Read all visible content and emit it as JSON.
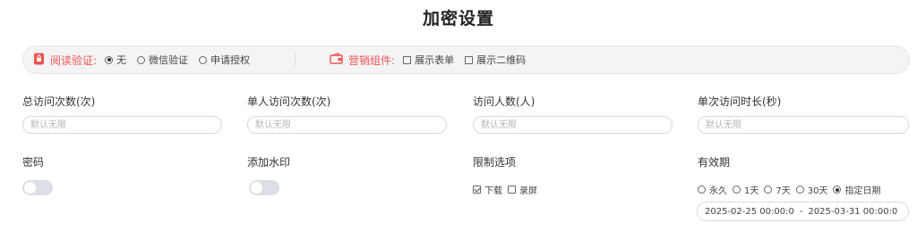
{
  "title": "加密设置",
  "read_verify": {
    "label": "阅读验证:",
    "options": [
      "无",
      "微信验证",
      "申请授权"
    ],
    "selected": 0
  },
  "marketing": {
    "label": "营销组件:",
    "options": [
      "展示表单",
      "展示二维码"
    ]
  },
  "fields": {
    "total_visits": {
      "label": "总访问次数(次)",
      "placeholder": "默认无限"
    },
    "single_visits": {
      "label": "单人访问次数(次)",
      "placeholder": "默认无限"
    },
    "visitors": {
      "label": "访问人数(人)",
      "placeholder": "默认无限"
    },
    "duration": {
      "label": "单次访问时长(秒)",
      "placeholder": "默认无限"
    }
  },
  "password": {
    "label": "密码",
    "enabled": false
  },
  "watermark": {
    "label": "添加水印",
    "enabled": false
  },
  "restrictions": {
    "label": "限制选项",
    "options": [
      "下载",
      "录屏"
    ],
    "checked": [
      true,
      false
    ]
  },
  "validity": {
    "label": "有效期",
    "options": [
      "永久",
      "1天",
      "7天",
      "30天",
      "指定日期"
    ],
    "selected": 4,
    "start": "2025-02-25 00:00:0",
    "separator": "-",
    "end": "2025-03-31 00:00:0"
  },
  "colors": {
    "accent": "#ef5350",
    "toggle_off": "#dcdfe6"
  }
}
